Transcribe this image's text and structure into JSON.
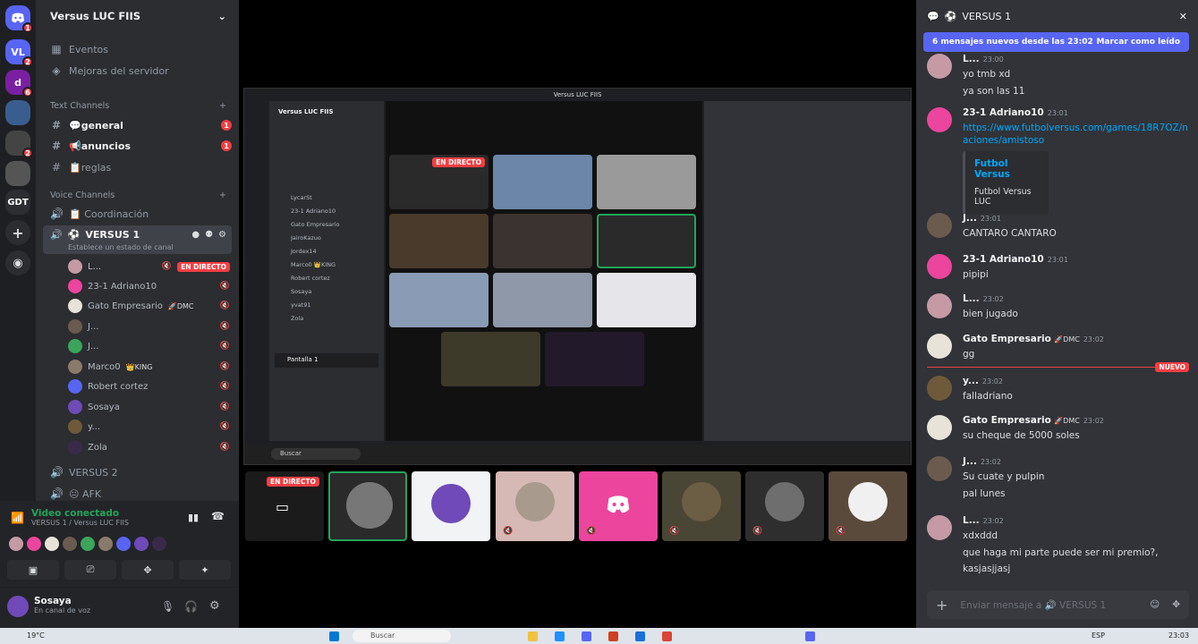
{
  "server": {
    "name": "Versus LUC FIIS",
    "rail": [
      {
        "label": "",
        "badge": "1",
        "color": "#5865f2"
      },
      {
        "label": "VL",
        "badge": "2",
        "color": "#5865f2"
      },
      {
        "label": "d",
        "badge": "6",
        "color": "#7a1fa2"
      },
      {
        "label": "",
        "badge": "",
        "color": "#3a5d8f"
      },
      {
        "label": "",
        "badge": "2",
        "color": "#444"
      },
      {
        "label": "",
        "badge": "",
        "color": "#555"
      },
      {
        "label": "GDT",
        "badge": "",
        "color": "#2b2d31"
      }
    ]
  },
  "nav": {
    "events": "Eventos",
    "boosts": "Mejoras del servidor"
  },
  "text_channels": {
    "label": "Text Channels",
    "items": [
      {
        "name": "💬general",
        "badge": "1"
      },
      {
        "name": "📢anuncios",
        "badge": "1"
      },
      {
        "name": "📋reglas",
        "badge": ""
      }
    ]
  },
  "voice_channels": {
    "label": "Voice Channels",
    "coordinacion": "📋 Coordinación",
    "active": "VERSUS 1",
    "active_status": "Establece un estado de canal",
    "users": [
      {
        "name": "L...",
        "live": "EN DIRECTO",
        "color": "#c59aa5"
      },
      {
        "name": "23-1 Adriano10",
        "live": "",
        "color": "#eb459e"
      },
      {
        "name": "Gato Empresario",
        "tag": "🚀DMC",
        "live": "",
        "color": "#e8e3d9"
      },
      {
        "name": "J...",
        "live": "",
        "color": "#6b5b4e"
      },
      {
        "name": "J...",
        "live": "",
        "color": "#3ba55c"
      },
      {
        "name": "Marco0",
        "tag": "👑KING",
        "live": "",
        "color": "#8a7a6a"
      },
      {
        "name": "Robert cortez",
        "live": "",
        "color": "#5865f2"
      },
      {
        "name": "Sosaya",
        "live": "",
        "color": "#6f4ab8"
      },
      {
        "name": "y...",
        "live": "",
        "color": "#6e5a3a"
      },
      {
        "name": "Zola",
        "live": "",
        "color": "#3a2a4a"
      }
    ],
    "versus2": "VERSUS 2",
    "afk": "😐 AFK"
  },
  "voice_panel": {
    "status": "Video conectado",
    "sub": "VERSUS 1 / Versus LUC FIIS"
  },
  "user": {
    "name": "Sosaya",
    "status": "En canal de voz"
  },
  "stream": {
    "window_title": "Versus LUC FIIS",
    "live_label": "EN DIRECTO",
    "inner_server": "Versus LUC FIIS",
    "inner_users": [
      "LycarSt",
      "23-1 Adriano10",
      "Gato Empresario",
      "JairoKazuo",
      "Jordex14",
      "Marco0 👑KING",
      "Robert cortez",
      "Sosaya",
      "yvat91",
      "Zola"
    ],
    "inner_screen": "Pantalla 1",
    "inner_search": "Buscar"
  },
  "chat": {
    "channel": "VERSUS 1",
    "new_banner": "6 mensajes nuevos desde las 23:02",
    "mark_read": "Marcar como leído",
    "new_label": "NUEVO",
    "input_placeholder": "Enviar mensaje a 🔊 VERSUS 1",
    "messages": [
      {
        "author": "L...",
        "time": "23:00",
        "lines": [
          "yo tmb xd",
          "ya son las 11"
        ],
        "color": "#c59aa5"
      },
      {
        "author": "23-1 Adriano10",
        "time": "23:01",
        "link": "https://www.futbolversus.com/games/18R7OZ/n",
        "link2": "aciones/amistoso",
        "embed_title": "Futbol Versus",
        "embed_desc": "Futbol Versus LUC",
        "color": "#eb459e"
      },
      {
        "author": "J...",
        "time": "23:01",
        "lines": [
          "CANTARO CANTARO"
        ],
        "color": "#6b5b4e"
      },
      {
        "author": "23-1 Adriano10",
        "time": "23:01",
        "lines": [
          "pipipi"
        ],
        "color": "#eb459e"
      },
      {
        "author": "L...",
        "time": "23:02",
        "lines": [
          "bien jugado"
        ],
        "color": "#c59aa5"
      },
      {
        "author": "Gato Empresario",
        "tag": "🚀DMC",
        "time": "23:02",
        "lines": [
          "gg"
        ],
        "color": "#e8e3d9"
      },
      {
        "author": "y...",
        "time": "23:02",
        "lines": [
          "falladriano"
        ],
        "color": "#6e5a3a"
      },
      {
        "author": "Gato Empresario",
        "tag": "🚀DMC",
        "time": "23:02",
        "lines": [
          "su cheque de 5000 soles"
        ],
        "color": "#e8e3d9"
      },
      {
        "author": "J...",
        "time": "23:02",
        "lines": [
          "Su cuate y pulpin",
          "pal lunes"
        ],
        "color": "#6b5b4e"
      },
      {
        "author": "L...",
        "time": "23:02",
        "lines": [
          "xdxddd",
          "que haga mi parte puede ser mi premio?,",
          "kasjasjjasj"
        ],
        "color": "#c59aa5"
      }
    ]
  },
  "taskbar": {
    "weather": "19°C",
    "search": "Buscar",
    "lang": "ESP",
    "time": "23:03"
  }
}
